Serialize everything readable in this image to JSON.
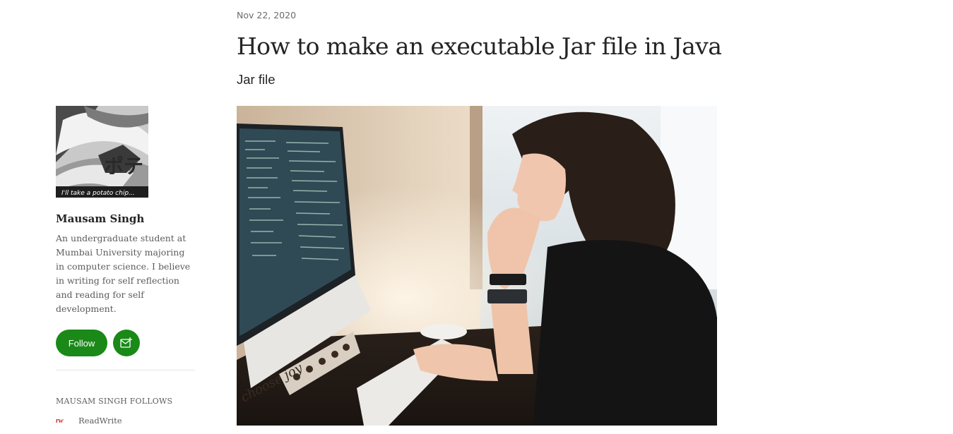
{
  "article": {
    "date": "Nov 22, 2020",
    "title": "How to make an executable Jar file in Java",
    "subtitle": "Jar file",
    "image_text": "choose joy"
  },
  "author": {
    "avatar_caption": "I'll take a potato chip...",
    "name": "Mausam Singh",
    "bio": "An undergraduate student at Mumbai University majoring in computer science. I believe in writing for self reflection and reading for self development.",
    "follow_label": "Follow"
  },
  "follows": {
    "heading": "MAUSAM SINGH FOLLOWS",
    "items": [
      {
        "logo_text": "rw",
        "label": "ReadWrite"
      }
    ]
  },
  "colors": {
    "accent": "#1a8917",
    "text": "#242424",
    "muted": "#5c5c5c",
    "readwrite_red": "#d6202a"
  },
  "icons": {
    "subscribe": "mail-plus-icon"
  }
}
